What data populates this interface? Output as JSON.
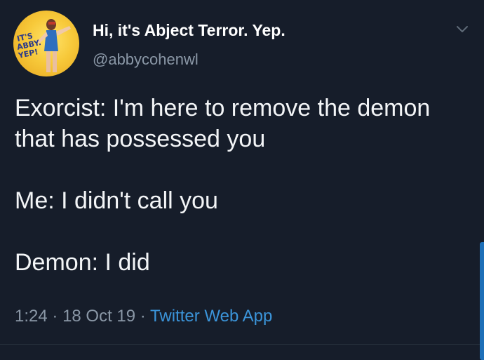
{
  "tweet": {
    "display_name": "Hi, it's Abject Terror. Yep.",
    "handle": "@abbycohenwl",
    "avatar_text": "IT'S ABBY. YEP!",
    "lines": [
      "Exorcist: I'm here to remove the demon that has possessed you",
      "Me: I didn't call you",
      "Demon: I did"
    ],
    "time": "1:24",
    "separator": "·",
    "date": "18 Oct 19",
    "source": "Twitter Web App"
  },
  "icons": {
    "menu": "chevron-down-icon"
  },
  "colors": {
    "background": "#161d2a",
    "secondary_text": "#8a97a6",
    "link": "#3b94d9",
    "avatar_bg": "#f7c93a"
  }
}
